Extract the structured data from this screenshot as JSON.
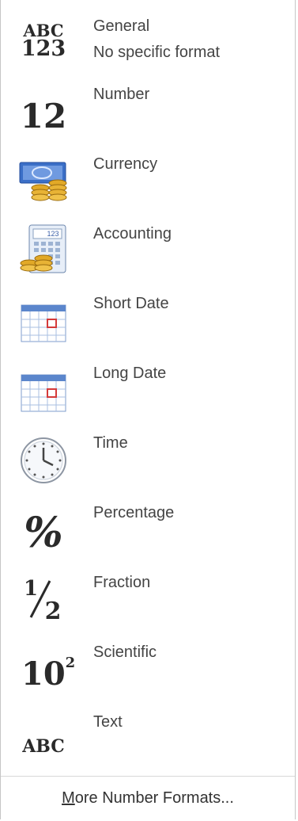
{
  "menu": {
    "items": [
      {
        "label": "General",
        "sublabel": "No specific format",
        "icon": "abc-123-icon"
      },
      {
        "label": "Number",
        "icon": "number-12-icon"
      },
      {
        "label": "Currency",
        "icon": "currency-icon"
      },
      {
        "label": "Accounting",
        "icon": "accounting-icon"
      },
      {
        "label": "Short Date",
        "icon": "calendar-icon"
      },
      {
        "label": "Long Date",
        "icon": "calendar-icon"
      },
      {
        "label": "Time",
        "icon": "clock-icon"
      },
      {
        "label": "Percentage",
        "icon": "percent-icon"
      },
      {
        "label": "Fraction",
        "icon": "fraction-icon"
      },
      {
        "label": "Scientific",
        "icon": "scientific-icon"
      },
      {
        "label": "Text",
        "icon": "abc-icon"
      }
    ],
    "icon_text": {
      "general_top": "ABC",
      "general_bottom": "123",
      "number": "12",
      "percent": "%",
      "fraction_num": "1",
      "fraction_den": "2",
      "sci_base": "10",
      "sci_exp": "2",
      "text": "ABC",
      "accounting_screen": "123"
    },
    "footer": {
      "mnemonic": "M",
      "rest": "ore Number Formats..."
    }
  }
}
